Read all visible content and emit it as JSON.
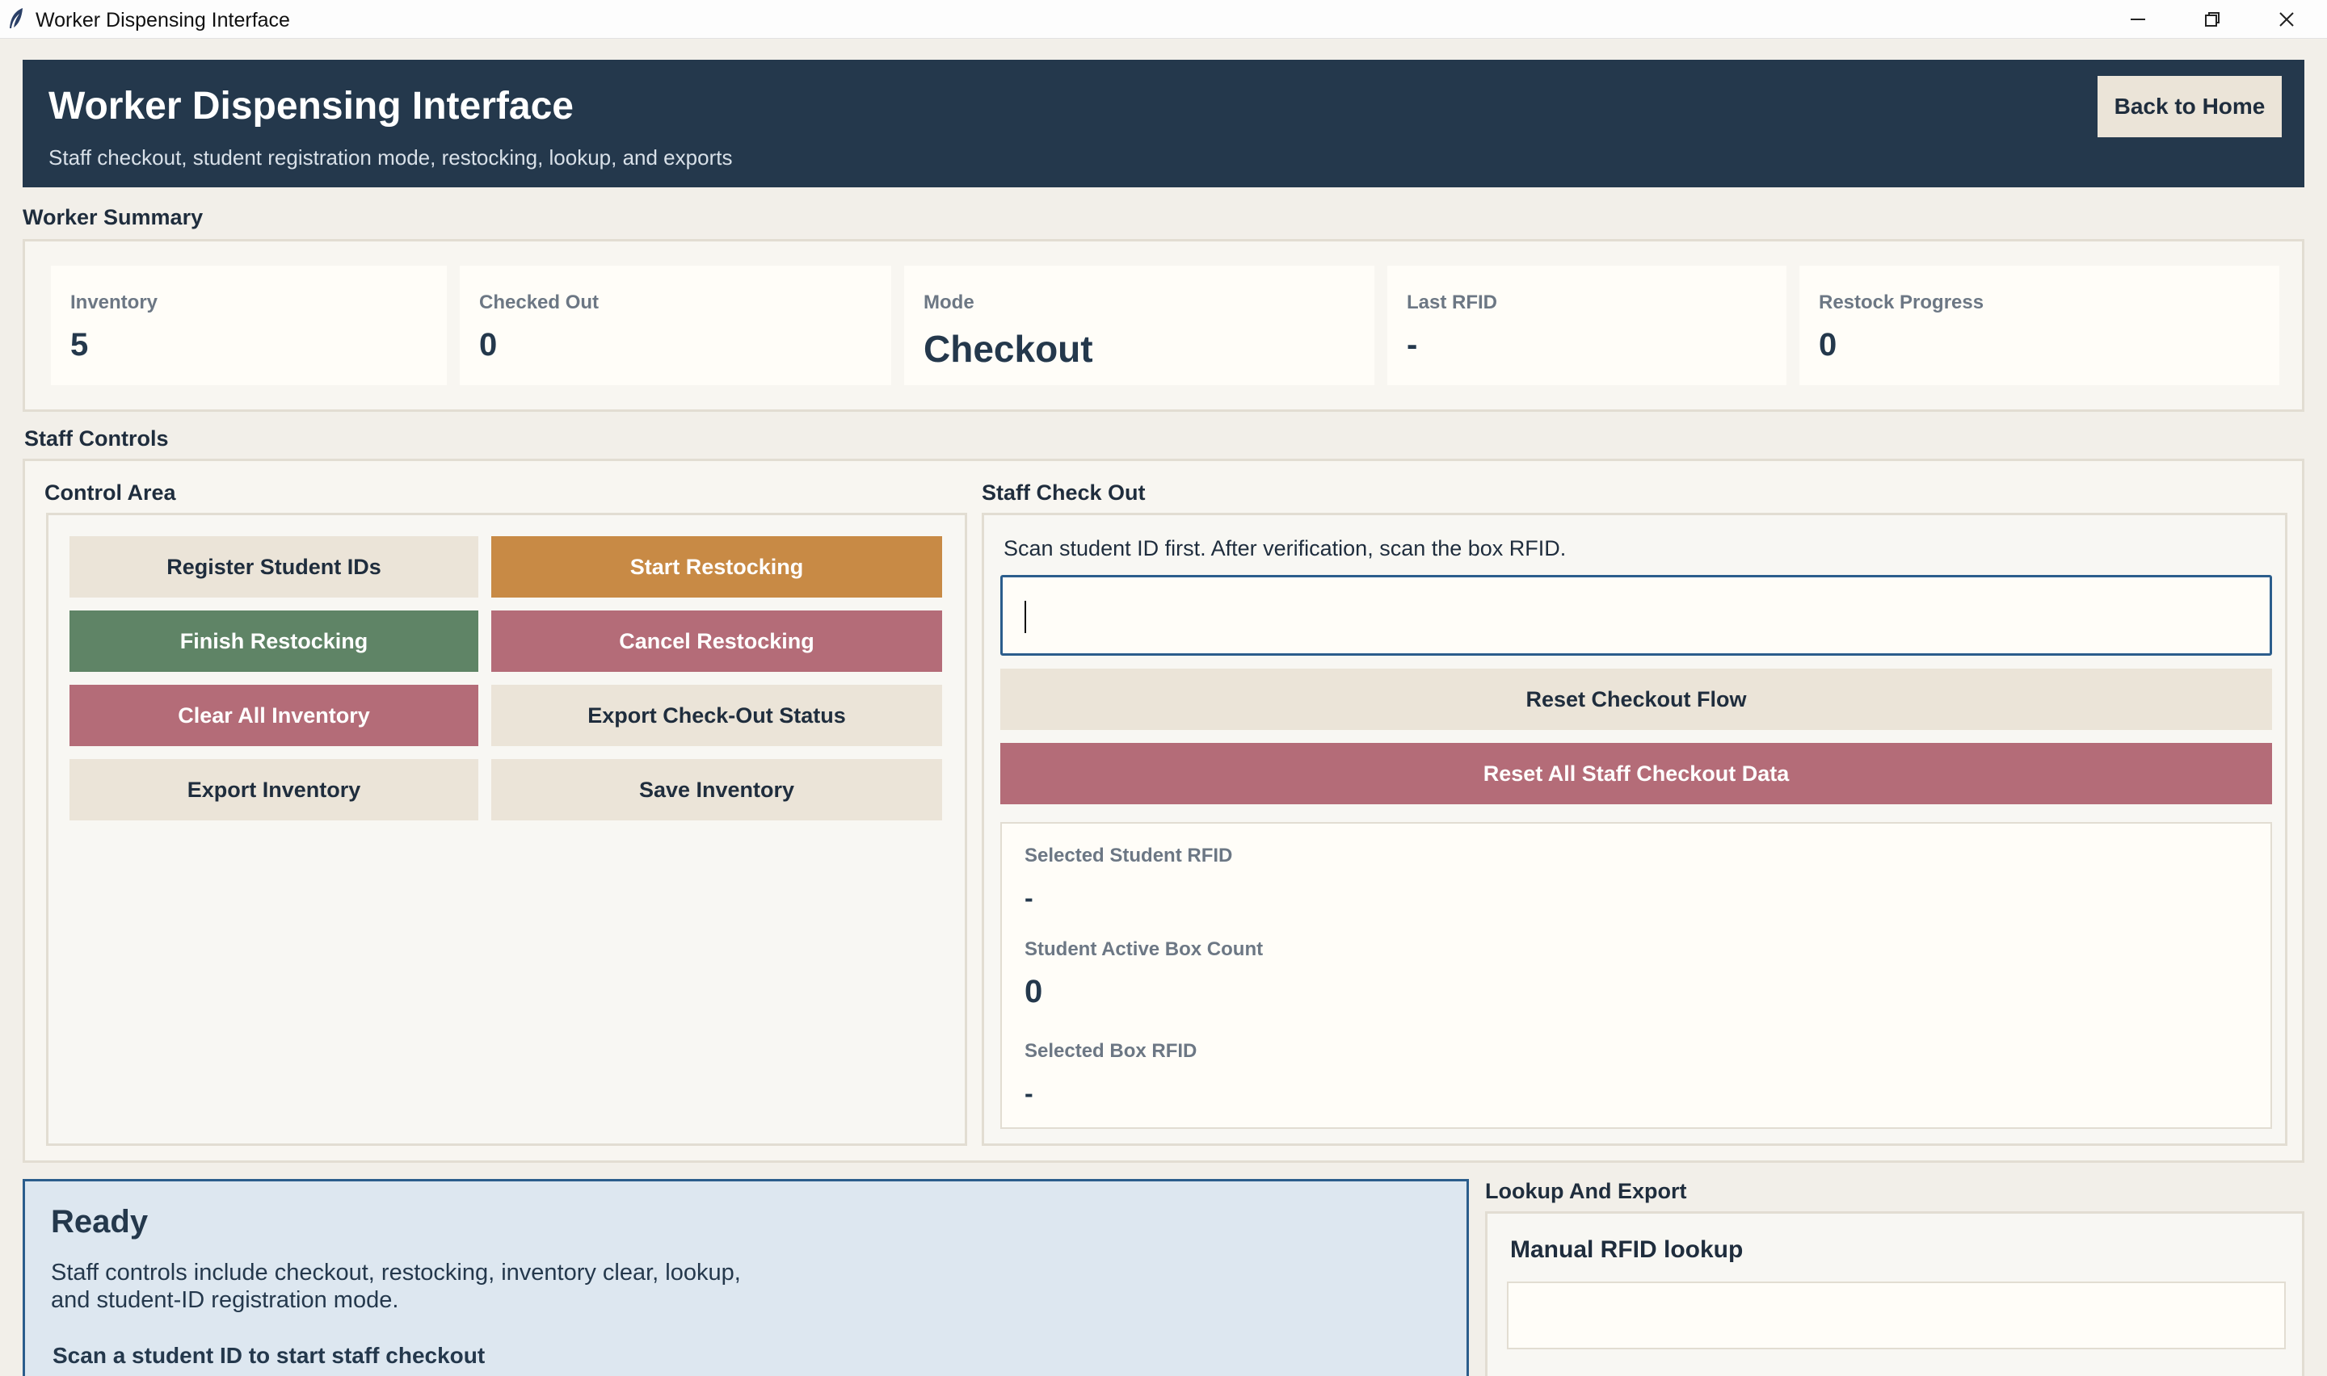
{
  "window": {
    "title": "Worker Dispensing Interface"
  },
  "header": {
    "title": "Worker Dispensing Interface",
    "subtitle": "Staff checkout, student registration mode, restocking, lookup, and exports",
    "back_button": "Back to Home"
  },
  "summary": {
    "label": "Worker Summary",
    "stats": [
      {
        "label": "Inventory",
        "value": "5"
      },
      {
        "label": "Checked Out",
        "value": "0"
      },
      {
        "label": "Mode",
        "value": "Checkout"
      },
      {
        "label": "Last RFID",
        "value": "-"
      },
      {
        "label": "Restock Progress",
        "value": "0"
      }
    ]
  },
  "staff_controls": {
    "label": "Staff Controls",
    "control_area": {
      "label": "Control Area",
      "buttons": [
        {
          "label": "Register Student IDs",
          "style": "neutral"
        },
        {
          "label": "Start Restocking",
          "style": "orange"
        },
        {
          "label": "Finish Restocking",
          "style": "green"
        },
        {
          "label": "Cancel Restocking",
          "style": "rose"
        },
        {
          "label": "Clear All Inventory",
          "style": "rose"
        },
        {
          "label": "Export Check-Out Status",
          "style": "neutral"
        },
        {
          "label": "Export Inventory",
          "style": "neutral"
        },
        {
          "label": "Save Inventory",
          "style": "neutral"
        }
      ]
    },
    "checkout": {
      "label": "Staff Check Out",
      "instruction": "Scan student ID first. After verification, scan the box RFID.",
      "input_value": "",
      "reset_flow_button": "Reset Checkout Flow",
      "reset_all_button": "Reset All Staff Checkout Data",
      "selected_student_rfid_label": "Selected Student RFID",
      "selected_student_rfid_value": "-",
      "active_box_count_label": "Student Active Box Count",
      "active_box_count_value": "0",
      "selected_box_rfid_label": "Selected Box RFID",
      "selected_box_rfid_value": "-"
    }
  },
  "status": {
    "title": "Ready",
    "description": "Staff controls include checkout, restocking, inventory clear, lookup, and student-ID registration mode.",
    "hint": "Scan a student ID to start staff checkout"
  },
  "lookup": {
    "label": "Lookup And Export",
    "title": "Manual RFID lookup",
    "input_value": ""
  },
  "colors": {
    "header_bg": "#24384c",
    "neutral_button": "#ebe4d8",
    "orange_button": "#c88a45",
    "green_button": "#5f8466",
    "rose_button": "#b46c78",
    "accent_border": "#2b5d8c",
    "status_bg": "#dde7f0"
  },
  "icons": {
    "app": "feather-icon",
    "minimize": "minimize-icon",
    "restore": "restore-icon",
    "close": "close-icon"
  }
}
